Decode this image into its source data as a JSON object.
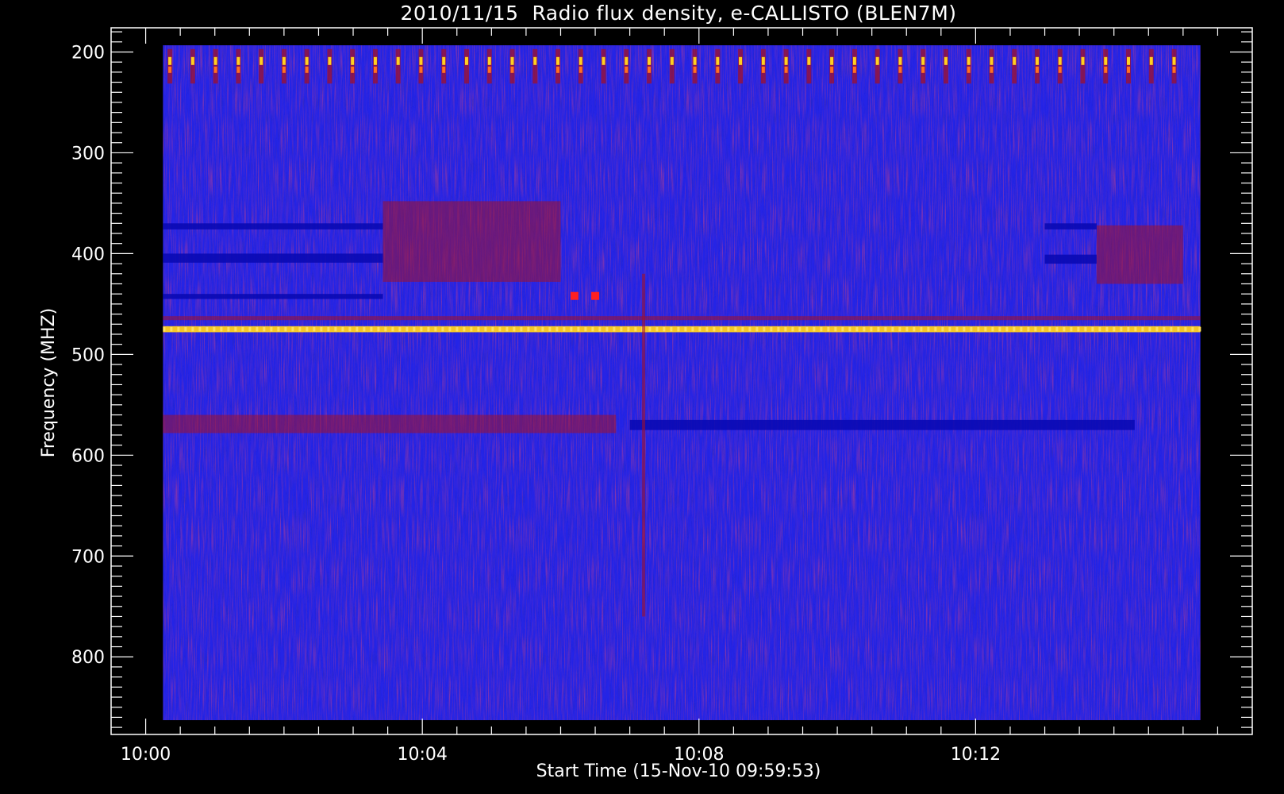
{
  "chart_data": {
    "type": "heatmap",
    "title": "2010/11/15  Radio flux density, e-CALLISTO (BLEN7M)",
    "xlabel": "Start Time (15-Nov-10 09:59:53)",
    "ylabel": "Frequency (MHZ)",
    "x_tick_labels": [
      "10:00",
      "10:04",
      "10:08",
      "10:12"
    ],
    "x_tick_minutes": [
      0,
      4,
      8,
      12
    ],
    "x_range_minutes": [
      -0.5,
      16.0
    ],
    "data_x_range_minutes": [
      0.25,
      15.25
    ],
    "y_tick_labels": [
      "200",
      "300",
      "400",
      "500",
      "600",
      "700",
      "800"
    ],
    "y_tick_values": [
      200,
      300,
      400,
      500,
      600,
      700,
      800
    ],
    "y_range": [
      176,
      877
    ],
    "y_inverted": true,
    "grid": false,
    "colormap": "blue-red-yellow",
    "background_level": "low (blue)",
    "features": [
      {
        "kind": "periodic-bursts",
        "freq_mhz": [
          205,
          225
        ],
        "time_min": [
          0.35,
          15.2
        ],
        "period_min": 0.33,
        "level": "high"
      },
      {
        "kind": "band",
        "freq_mhz": [
          472,
          478
        ],
        "time_min": [
          0.25,
          15.25
        ],
        "level": "high"
      },
      {
        "kind": "band",
        "freq_mhz": [
          462,
          466
        ],
        "time_min": [
          0.25,
          15.25
        ],
        "level": "medium"
      },
      {
        "kind": "band-low",
        "freq_mhz": [
          370,
          376
        ],
        "time_min": [
          0.25,
          3.43
        ],
        "level": "low"
      },
      {
        "kind": "band-low",
        "freq_mhz": [
          400,
          409
        ],
        "time_min": [
          0.25,
          3.43
        ],
        "level": "low"
      },
      {
        "kind": "band-low",
        "freq_mhz": [
          440,
          445
        ],
        "time_min": [
          0.25,
          3.43
        ],
        "level": "low"
      },
      {
        "kind": "band",
        "freq_mhz": [
          348,
          428
        ],
        "time_min": [
          3.43,
          6.0
        ],
        "level": "medium"
      },
      {
        "kind": "band-low",
        "freq_mhz": [
          370,
          376
        ],
        "time_min": [
          13.0,
          13.75
        ],
        "level": "low"
      },
      {
        "kind": "band-low",
        "freq_mhz": [
          401,
          410
        ],
        "time_min": [
          13.0,
          13.75
        ],
        "level": "low"
      },
      {
        "kind": "band",
        "freq_mhz": [
          372,
          430
        ],
        "time_min": [
          13.75,
          15.0
        ],
        "level": "medium"
      },
      {
        "kind": "band",
        "freq_mhz": [
          560,
          578
        ],
        "time_min": [
          0.25,
          6.8
        ],
        "level": "medium"
      },
      {
        "kind": "band-low",
        "freq_mhz": [
          565,
          575
        ],
        "time_min": [
          7.0,
          14.3
        ],
        "level": "low"
      },
      {
        "kind": "vertical-streak",
        "time_min": 7.2,
        "freq_mhz": [
          420,
          760
        ],
        "level": "medium"
      },
      {
        "kind": "spot",
        "time_min": 6.2,
        "freq_mhz": 442,
        "level": "high"
      },
      {
        "kind": "spot",
        "time_min": 6.5,
        "freq_mhz": 442,
        "level": "high"
      }
    ],
    "colors": {
      "background": "#000000",
      "foreground": "#ffffff",
      "low": "#0a0ab4",
      "base": "#2424e6",
      "medium": "#a0102a",
      "high": "#ffd020"
    }
  }
}
